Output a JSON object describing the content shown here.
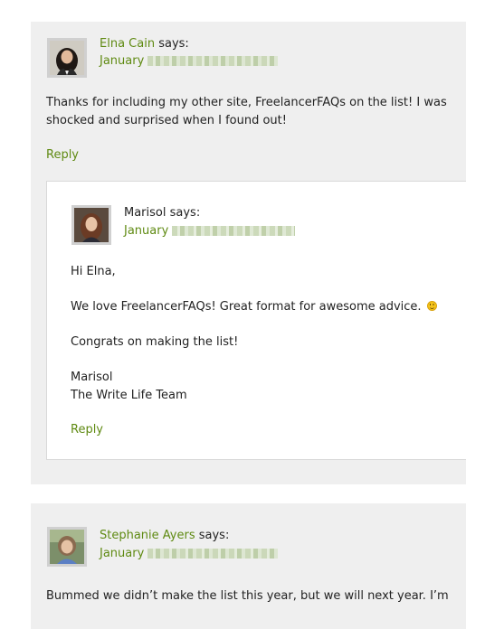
{
  "comments": [
    {
      "author": "Elna Cain",
      "says": "says:",
      "date_month": "January",
      "body": [
        "Thanks for including my other site, FreelancerFAQs on the list! I was",
        "shocked and surprised when I found out!"
      ],
      "reply_label": "Reply",
      "replies": [
        {
          "author": "Marisol",
          "says": "says:",
          "date_month": "January",
          "body": [
            "Hi Elna,",
            "We love FreelancerFAQs! Great format for awesome advice.",
            "Congrats on making the list!",
            "Marisol",
            "The Write Life Team"
          ],
          "reply_label": "Reply"
        }
      ]
    },
    {
      "author": "Stephanie Ayers",
      "says": "says:",
      "date_month": "January",
      "body": [
        "Bummed we didn’t make the list this year, but we will next year. I’m"
      ]
    }
  ],
  "icons": {
    "smiley": "smiley-emoji-icon"
  },
  "colors": {
    "link_green": "#5f8a12",
    "card_background": "#efefef",
    "nested_background": "#ffffff",
    "text": "#222222"
  }
}
